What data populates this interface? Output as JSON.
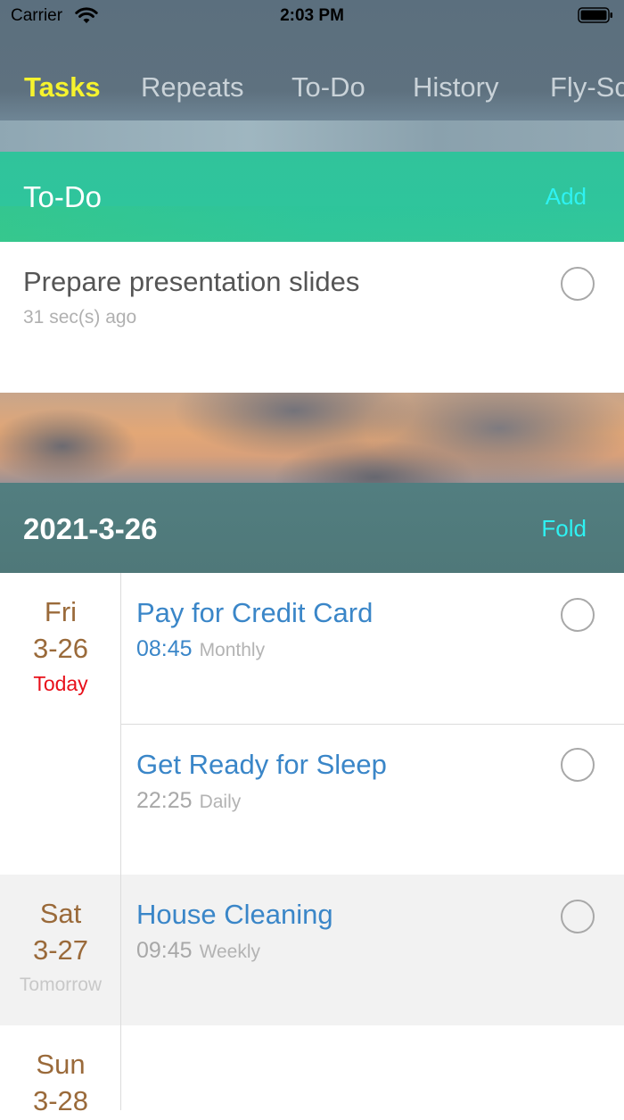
{
  "status_bar": {
    "carrier": "Carrier",
    "time": "2:03 PM",
    "icons": [
      "wifi-icon",
      "battery-icon"
    ]
  },
  "tabs": [
    {
      "label": "Tasks",
      "active": true
    },
    {
      "label": "Repeats",
      "active": false
    },
    {
      "label": "To-Do",
      "active": false
    },
    {
      "label": "History",
      "active": false
    },
    {
      "label": "Fly-Sc",
      "active": false
    }
  ],
  "todo_section": {
    "title": "To-Do",
    "action": "Add",
    "items": [
      {
        "title": "Prepare presentation slides",
        "subtitle": "31 sec(s) ago"
      }
    ]
  },
  "date_section": {
    "title": "2021-3-26",
    "action": "Fold"
  },
  "days": [
    {
      "dow": "Fri",
      "date": "3-26",
      "relative": "Today",
      "relative_color": "#e8101a",
      "tasks": [
        {
          "name": "Pay for Credit Card",
          "time": "08:45",
          "time_color": "#3a86c8",
          "frequency": "Monthly"
        },
        {
          "name": "Get Ready for Sleep",
          "time": "22:25",
          "time_color": "#a8a8a8",
          "frequency": "Daily"
        }
      ]
    },
    {
      "dow": "Sat",
      "date": "3-27",
      "relative": "Tomorrow",
      "relative_color": "#c8c8c8",
      "tasks": [
        {
          "name": "House Cleaning",
          "time": "09:45",
          "time_color": "#a8a8a8",
          "frequency": "Weekly"
        }
      ]
    },
    {
      "dow": "Sun",
      "date": "3-28",
      "relative": "",
      "tasks": []
    }
  ],
  "colors": {
    "accent_tab": "#f6f32e",
    "todo_bar": "#30c39b",
    "action_text": "#2ef2f2",
    "task_title": "#3a86c8",
    "day_label": "#9a6a3a"
  }
}
